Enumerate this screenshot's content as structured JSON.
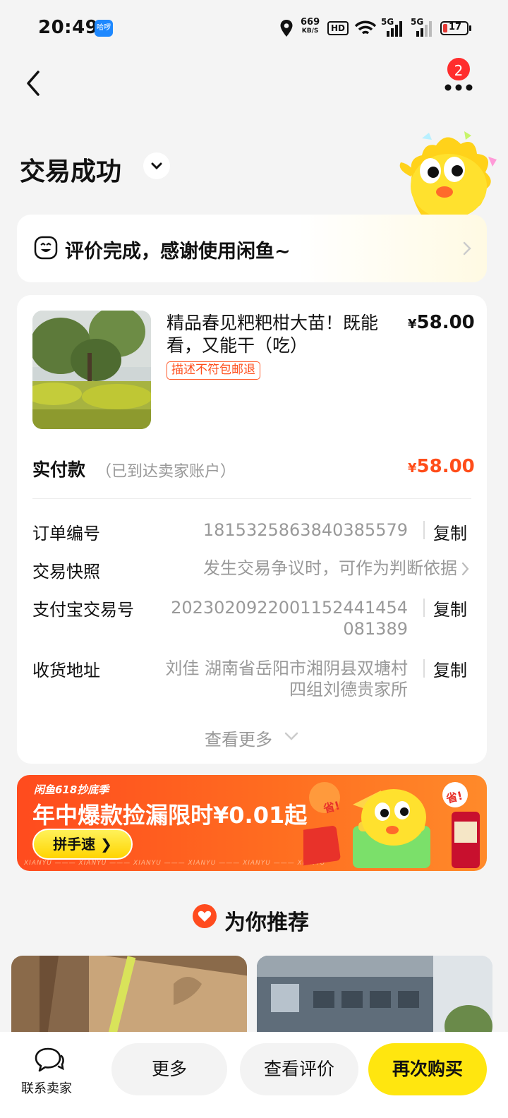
{
  "status_bar": {
    "time": "20:49",
    "app_badge": "哈啰",
    "speed_value": "669",
    "speed_unit": "KB/S",
    "hd": "HD",
    "net1": "5G",
    "net2": "5G",
    "battery": "17"
  },
  "nav": {
    "notification_count": "2"
  },
  "order_status": {
    "title": "交易成功"
  },
  "review": {
    "text": "评价完成，感谢使用闲鱼~"
  },
  "product": {
    "title": "精品春见粑粑柑大苗！既能看，又能干（吃）",
    "tag": "描述不符包邮退",
    "price_symbol": "¥",
    "price": "58.00"
  },
  "payment": {
    "label": "实付款",
    "note": "（已到达卖家账户）",
    "symbol": "¥",
    "amount": "58.00"
  },
  "details": {
    "order_no_label": "订单编号",
    "order_no": "1815325863840385579",
    "snapshot_label": "交易快照",
    "snapshot_value": "发生交易争议时，可作为判断依据",
    "alipay_label": "支付宝交易号",
    "alipay_line1": "2023020922001152441454",
    "alipay_line2": "081389",
    "address_label": "收货地址",
    "address_line1": "刘佳 湖南省岳阳市湘阴县双塘村",
    "address_line2": "四组刘德贵家所",
    "copy_label": "复制",
    "see_more": "查看更多"
  },
  "banner": {
    "subtitle": "闲鱼618抄底季",
    "title": "年中爆款捡漏限时¥0.01起",
    "button": "拼手速",
    "footer": "XIANYU ——— XIANYU ——— XIANYU ——— XIANYU ——— XIANYU ——— XIANYU",
    "badge1": "省!",
    "badge2": "省!"
  },
  "recommend": {
    "title": "为你推荐"
  },
  "bottom": {
    "contact": "联系卖家",
    "more": "更多",
    "view_review": "查看评价",
    "rebuy": "再次购买"
  },
  "colors": {
    "accent_yellow": "#ffe60f",
    "price_orange": "#ff4d1a",
    "banner_orange": "#ff5a1f",
    "badge_red": "#ff2d2d"
  }
}
